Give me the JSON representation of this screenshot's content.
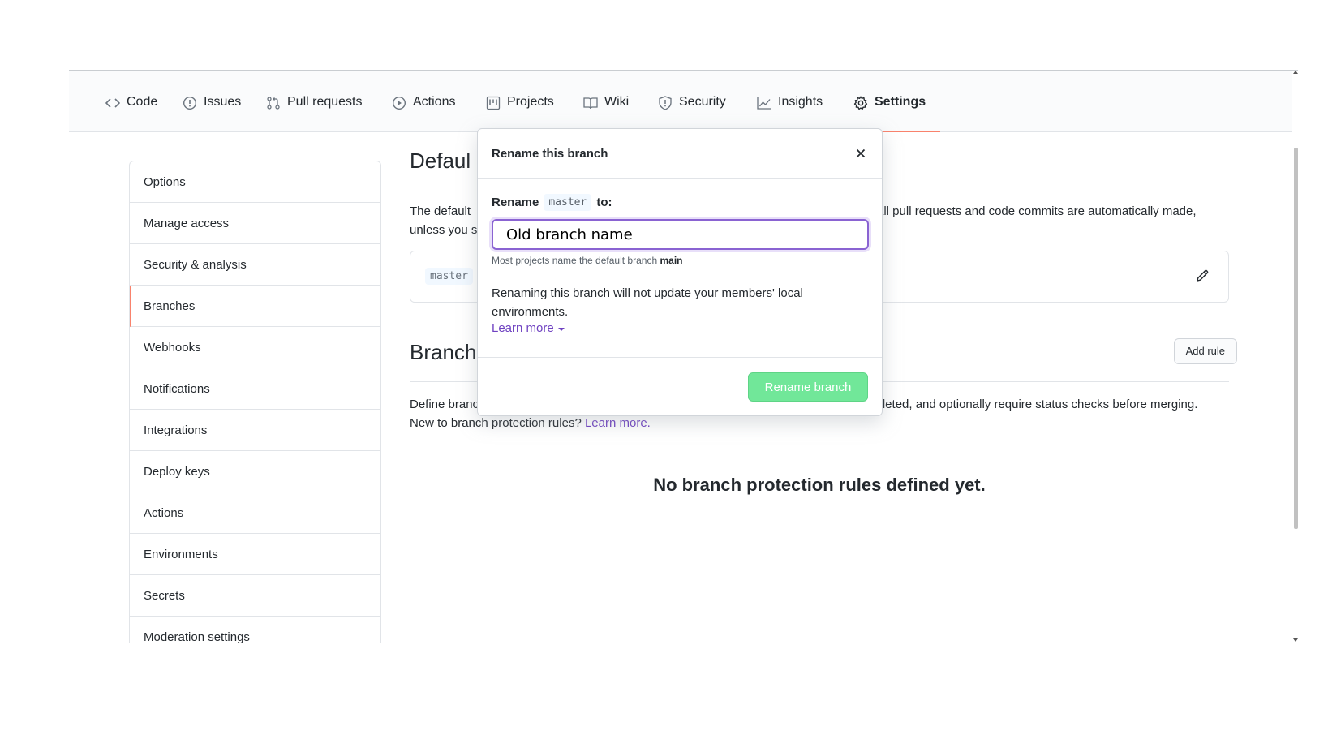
{
  "tabs": [
    {
      "label": "Code",
      "icon": "code-icon"
    },
    {
      "label": "Issues",
      "icon": "issue-opened-icon"
    },
    {
      "label": "Pull requests",
      "icon": "git-pull-request-icon"
    },
    {
      "label": "Actions",
      "icon": "play-icon"
    },
    {
      "label": "Projects",
      "icon": "project-icon"
    },
    {
      "label": "Wiki",
      "icon": "book-icon"
    },
    {
      "label": "Security",
      "icon": "shield-icon"
    },
    {
      "label": "Insights",
      "icon": "graph-icon"
    },
    {
      "label": "Settings",
      "icon": "gear-icon",
      "active": true
    }
  ],
  "sidebar": {
    "items": [
      {
        "label": "Options"
      },
      {
        "label": "Manage access"
      },
      {
        "label": "Security & analysis"
      },
      {
        "label": "Branches",
        "active": true
      },
      {
        "label": "Webhooks"
      },
      {
        "label": "Notifications"
      },
      {
        "label": "Integrations"
      },
      {
        "label": "Deploy keys"
      },
      {
        "label": "Actions"
      },
      {
        "label": "Environments"
      },
      {
        "label": "Secrets"
      },
      {
        "label": "Moderation settings"
      }
    ]
  },
  "main": {
    "default_title": "Defaul",
    "default_desc_left": "The default",
    "default_desc_right": "all pull requests and code commits are automatically made,",
    "default_desc_line2": "unless you s",
    "default_branch": "master",
    "protection_title": "Branch",
    "add_rule_label": "Add rule",
    "protection_desc": "Define branch protection rules to disable force pushing, prevent branches from being deleted, and optionally require status checks before merging. New to branch protection rules?",
    "protection_learn_more": "Learn more.",
    "blank_state": "No branch protection rules defined yet."
  },
  "dialog": {
    "title": "Rename this branch",
    "rename_prefix": "Rename",
    "current_branch": "master",
    "rename_suffix": "to:",
    "input_value": "Old branch name",
    "hint_prefix": "Most projects name the default branch",
    "hint_branch": "main",
    "note": "Renaming this branch will not update your members' local environments.",
    "learn_more": "Learn more",
    "submit_label": "Rename branch"
  },
  "colors": {
    "accent_underline": "#f9826c",
    "link": "#6f42c1",
    "primary_button_disabled": "#62e58e",
    "input_focus": "#8a63d2"
  }
}
